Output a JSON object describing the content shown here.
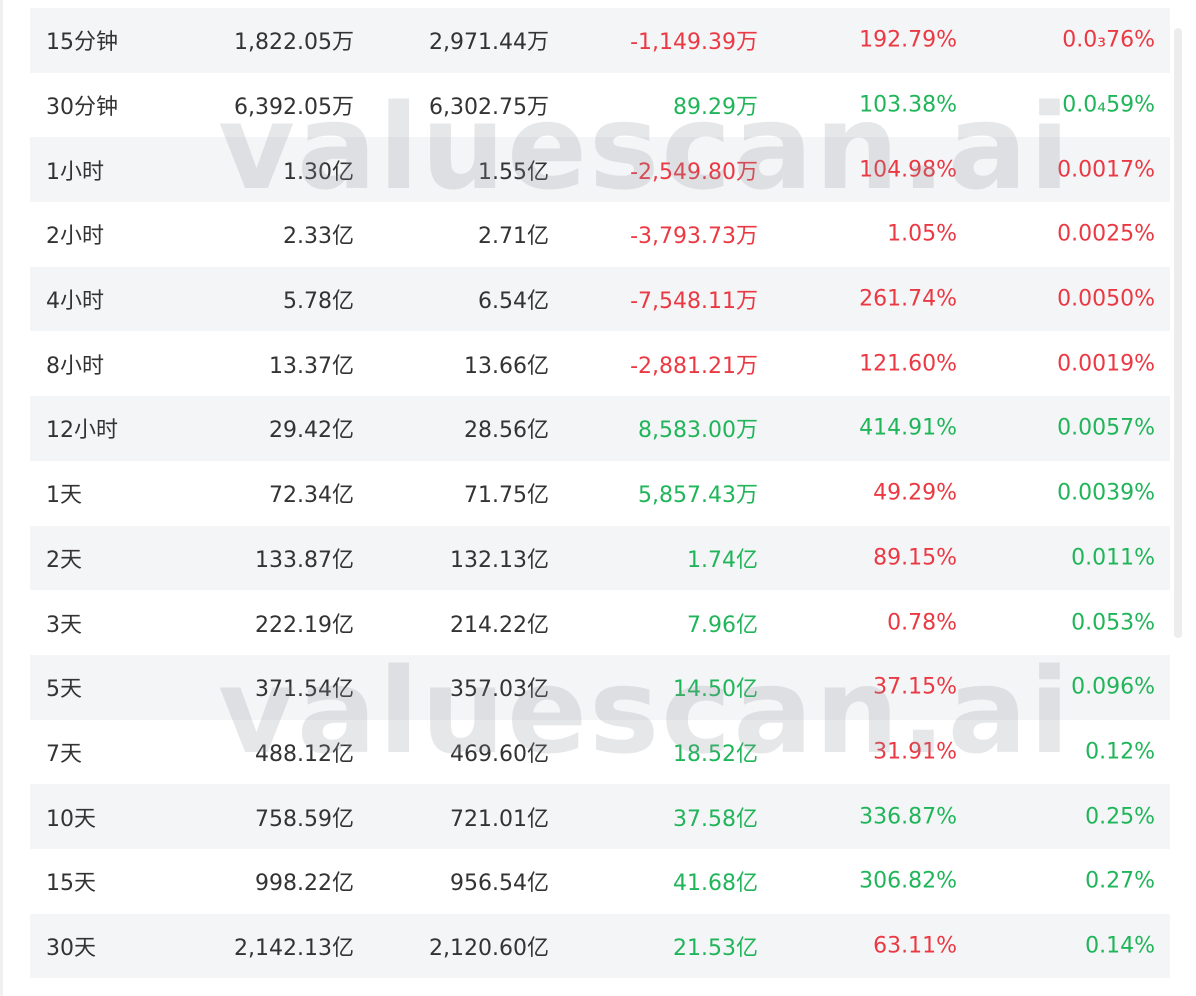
{
  "watermark": "valuescan.ai",
  "colors": {
    "red": "#ea3943",
    "green": "#21b55a",
    "text": "#333333",
    "stripe": "#f4f5f7"
  },
  "rows": [
    {
      "period": "15分钟",
      "v1": "1,822.05万",
      "v2": "2,971.44万",
      "v3": "-1,149.39万",
      "v3c": "red",
      "v4": "192.79%",
      "v4c": "red",
      "v5": "0.0₃76%",
      "v5c": "red"
    },
    {
      "period": "30分钟",
      "v1": "6,392.05万",
      "v2": "6,302.75万",
      "v3": "89.29万",
      "v3c": "green",
      "v4": "103.38%",
      "v4c": "green",
      "v5": "0.0₄59%",
      "v5c": "green"
    },
    {
      "period": "1小时",
      "v1": "1.30亿",
      "v2": "1.55亿",
      "v3": "-2,549.80万",
      "v3c": "red",
      "v4": "104.98%",
      "v4c": "red",
      "v5": "0.0017%",
      "v5c": "red"
    },
    {
      "period": "2小时",
      "v1": "2.33亿",
      "v2": "2.71亿",
      "v3": "-3,793.73万",
      "v3c": "red",
      "v4": "1.05%",
      "v4c": "red",
      "v5": "0.0025%",
      "v5c": "red"
    },
    {
      "period": "4小时",
      "v1": "5.78亿",
      "v2": "6.54亿",
      "v3": "-7,548.11万",
      "v3c": "red",
      "v4": "261.74%",
      "v4c": "red",
      "v5": "0.0050%",
      "v5c": "red"
    },
    {
      "period": "8小时",
      "v1": "13.37亿",
      "v2": "13.66亿",
      "v3": "-2,881.21万",
      "v3c": "red",
      "v4": "121.60%",
      "v4c": "red",
      "v5": "0.0019%",
      "v5c": "red"
    },
    {
      "period": "12小时",
      "v1": "29.42亿",
      "v2": "28.56亿",
      "v3": "8,583.00万",
      "v3c": "green",
      "v4": "414.91%",
      "v4c": "green",
      "v5": "0.0057%",
      "v5c": "green"
    },
    {
      "period": "1天",
      "v1": "72.34亿",
      "v2": "71.75亿",
      "v3": "5,857.43万",
      "v3c": "green",
      "v4": "49.29%",
      "v4c": "red",
      "v5": "0.0039%",
      "v5c": "green"
    },
    {
      "period": "2天",
      "v1": "133.87亿",
      "v2": "132.13亿",
      "v3": "1.74亿",
      "v3c": "green",
      "v4": "89.15%",
      "v4c": "red",
      "v5": "0.011%",
      "v5c": "green"
    },
    {
      "period": "3天",
      "v1": "222.19亿",
      "v2": "214.22亿",
      "v3": "7.96亿",
      "v3c": "green",
      "v4": "0.78%",
      "v4c": "red",
      "v5": "0.053%",
      "v5c": "green"
    },
    {
      "period": "5天",
      "v1": "371.54亿",
      "v2": "357.03亿",
      "v3": "14.50亿",
      "v3c": "green",
      "v4": "37.15%",
      "v4c": "red",
      "v5": "0.096%",
      "v5c": "green"
    },
    {
      "period": "7天",
      "v1": "488.12亿",
      "v2": "469.60亿",
      "v3": "18.52亿",
      "v3c": "green",
      "v4": "31.91%",
      "v4c": "red",
      "v5": "0.12%",
      "v5c": "green"
    },
    {
      "period": "10天",
      "v1": "758.59亿",
      "v2": "721.01亿",
      "v3": "37.58亿",
      "v3c": "green",
      "v4": "336.87%",
      "v4c": "green",
      "v5": "0.25%",
      "v5c": "green"
    },
    {
      "period": "15天",
      "v1": "998.22亿",
      "v2": "956.54亿",
      "v3": "41.68亿",
      "v3c": "green",
      "v4": "306.82%",
      "v4c": "green",
      "v5": "0.27%",
      "v5c": "green"
    },
    {
      "period": "30天",
      "v1": "2,142.13亿",
      "v2": "2,120.60亿",
      "v3": "21.53亿",
      "v3c": "green",
      "v4": "63.11%",
      "v4c": "red",
      "v5": "0.14%",
      "v5c": "green"
    }
  ]
}
